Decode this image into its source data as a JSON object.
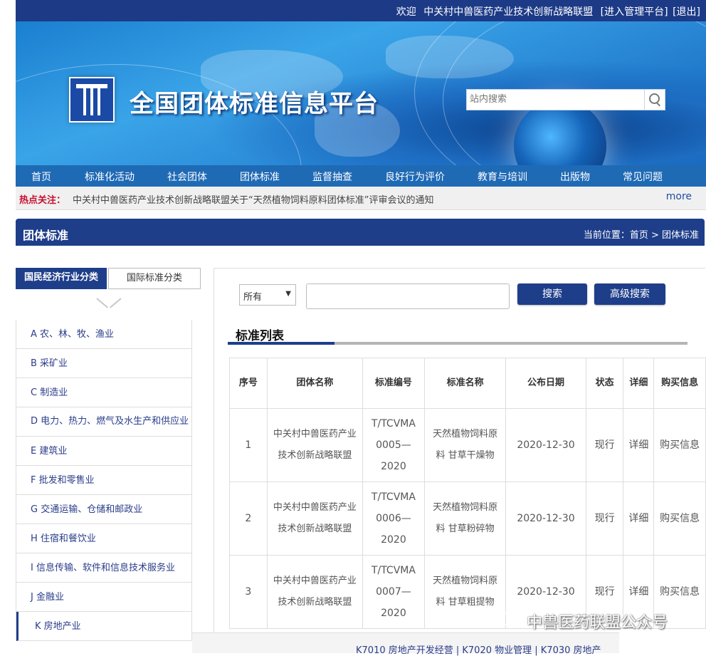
{
  "topbar": {
    "welcome": "欢迎",
    "org_name": "中关村中兽医药产业技术创新战略联盟",
    "admin_link": "[进入管理平台]",
    "logout_link": "[退出]"
  },
  "banner": {
    "site_title": "全国团体标准信息平台",
    "search_placeholder": "站内搜索"
  },
  "nav": {
    "items": [
      "首页",
      "标准化活动",
      "社会团体",
      "团体标准",
      "监督抽查",
      "良好行为评价",
      "教育与培训",
      "出版物",
      "常见问题"
    ]
  },
  "hot": {
    "label": "热点关注：",
    "text": "中关村中兽医药产业技术创新战略联盟关于“天然植物饲料原料团体标准”评审会议的通知",
    "more": "more"
  },
  "section": {
    "title": "团体标准",
    "breadcrumb": "当前位置：首页 > 团体标准"
  },
  "categories": {
    "tabs": [
      "国民经济行业分类",
      "国际标准分类"
    ],
    "items": [
      "A 农、林、牧、渔业",
      "B 采矿业",
      "C 制造业",
      "D 电力、热力、燃气及水生产和供应业",
      "E 建筑业",
      "F 批发和零售业",
      "G 交通运输、仓储和邮政业",
      "H 住宿和餐饮业",
      "I 信息传输、软件和信息技术服务业",
      "J 金融业",
      "K 房地产业"
    ]
  },
  "search": {
    "scope_value": "所有",
    "search_button": "搜索",
    "advanced_button": "高级搜索"
  },
  "list": {
    "title": "标准列表",
    "headers": [
      "序号",
      "团体名称",
      "标准编号",
      "标准名称",
      "公布日期",
      "状态",
      "详细",
      "购买信息"
    ],
    "rows": [
      {
        "no": "1",
        "org": "中关村中兽医药产业技术创新战略联盟",
        "code": "T/TCVMA 0005—2020",
        "name": "天然植物饲料原料 甘草干燥物",
        "date": "2020-12-30",
        "status": "现行",
        "detail": "详细",
        "buy": "购买信息"
      },
      {
        "no": "2",
        "org": "中关村中兽医药产业技术创新战略联盟",
        "code": "T/TCVMA 0006—2020",
        "name": "天然植物饲料原料 甘草粉碎物",
        "date": "2020-12-30",
        "status": "现行",
        "detail": "详细",
        "buy": "购买信息"
      },
      {
        "no": "3",
        "org": "中关村中兽医药产业技术创新战略联盟",
        "code": "T/TCVMA 0007—2020",
        "name": "天然植物饲料原料 甘草粗提物",
        "date": "2020-12-30",
        "status": "现行",
        "detail": "详细",
        "buy": "购买信息"
      }
    ]
  },
  "footer": {
    "sub_links": "K7010 房地产开发经营 | K7020 物业管理 | K7030 房地产"
  },
  "watermark": "中兽医药联盟公众号"
}
